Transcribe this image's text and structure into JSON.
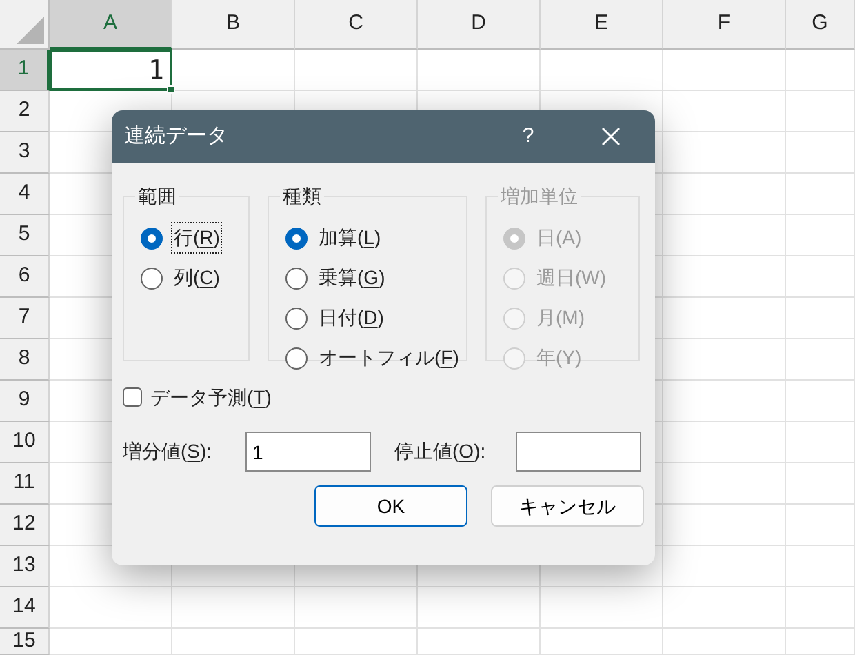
{
  "spreadsheet": {
    "columns": [
      {
        "label": "A",
        "selected": true
      },
      {
        "label": "B",
        "selected": false
      },
      {
        "label": "C",
        "selected": false
      },
      {
        "label": "D",
        "selected": false
      },
      {
        "label": "E",
        "selected": false
      },
      {
        "label": "F",
        "selected": false
      },
      {
        "label": "G",
        "selected": false
      }
    ],
    "rows": [
      {
        "label": "1",
        "selected": true
      },
      {
        "label": "2",
        "selected": false
      },
      {
        "label": "3",
        "selected": false
      },
      {
        "label": "4",
        "selected": false
      },
      {
        "label": "5",
        "selected": false
      },
      {
        "label": "6",
        "selected": false
      },
      {
        "label": "7",
        "selected": false
      },
      {
        "label": "8",
        "selected": false
      },
      {
        "label": "9",
        "selected": false
      },
      {
        "label": "10",
        "selected": false
      },
      {
        "label": "11",
        "selected": false
      },
      {
        "label": "12",
        "selected": false
      },
      {
        "label": "13",
        "selected": false
      },
      {
        "label": "14",
        "selected": false
      },
      {
        "label": "15",
        "selected": false
      }
    ],
    "active_cell": {
      "value": "1"
    }
  },
  "dialog": {
    "title": "連続データ",
    "help": "?",
    "groups": [
      {
        "title": "範囲",
        "disabled": false,
        "options": [
          {
            "label": "行(",
            "accel": "R",
            "label_end": ")",
            "selected": true,
            "focused": true
          },
          {
            "label": "列(",
            "accel": "C",
            "label_end": ")",
            "selected": false,
            "focused": false
          }
        ]
      },
      {
        "title": "種類",
        "disabled": false,
        "options": [
          {
            "label": "加算(",
            "accel": "L",
            "label_end": ")",
            "selected": true,
            "focused": false
          },
          {
            "label": "乗算(",
            "accel": "G",
            "label_end": ")",
            "selected": false,
            "focused": false
          },
          {
            "label": "日付(",
            "accel": "D",
            "label_end": ")",
            "selected": false,
            "focused": false
          },
          {
            "label": "オートフィル(",
            "accel": "F",
            "label_end": ")",
            "selected": false,
            "focused": false
          }
        ]
      },
      {
        "title": "増加単位",
        "disabled": true,
        "options": [
          {
            "label": "日(A)",
            "selected": true,
            "focused": false
          },
          {
            "label": "週日(W)",
            "selected": false,
            "focused": false
          },
          {
            "label": "月(M)",
            "selected": false,
            "focused": false
          },
          {
            "label": "年(Y)",
            "selected": false,
            "focused": false
          }
        ]
      }
    ],
    "checkbox": {
      "label": "データ予測(",
      "accel": "T",
      "label_end": ")",
      "checked": false
    },
    "fields": [
      {
        "label": "増分値(",
        "accel": "S",
        "label_end": "):",
        "value": "1"
      },
      {
        "label": "停止値(",
        "accel": "O",
        "label_end": "):"
      }
    ],
    "buttons": [
      {
        "label": "OK",
        "default": true
      },
      {
        "label": "キャンセル",
        "default": false
      }
    ]
  }
}
